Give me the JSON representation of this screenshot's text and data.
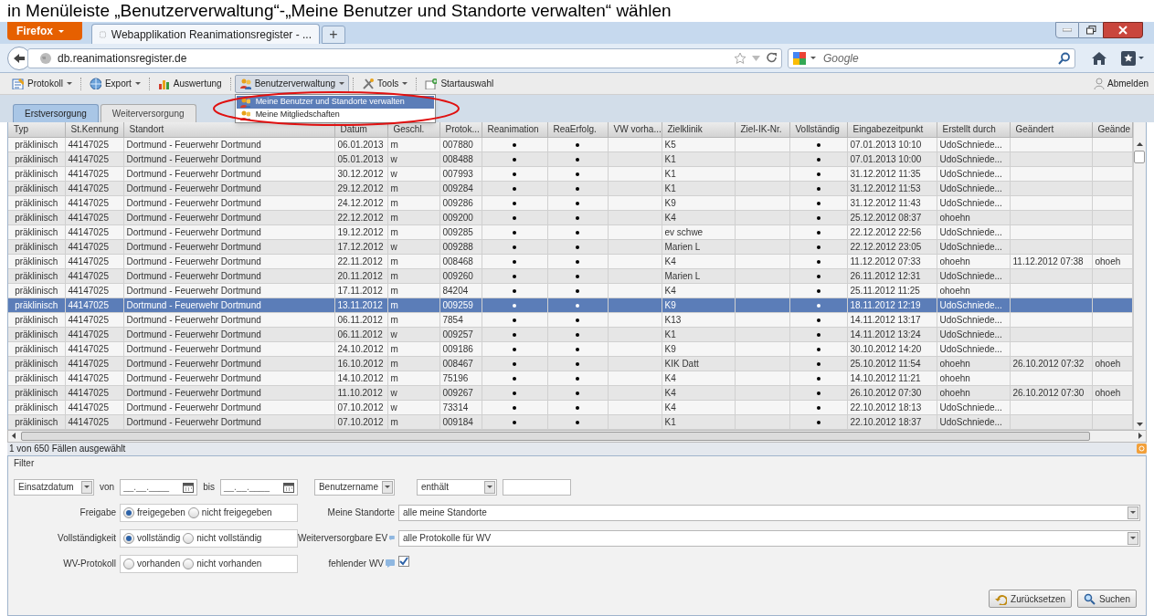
{
  "caption": "in Menüleiste „Benutzerverwaltung“-„Meine Benutzer und Standorte verwalten“ wählen",
  "browser": {
    "menu_button": "Firefox",
    "tabs": [
      {
        "title": "Webapplikation Reanimationsregister - ...",
        "selected": true
      }
    ],
    "new_tab": "+",
    "url": "db.reanimationsregister.de",
    "search_placeholder": "Google"
  },
  "toolbar": [
    {
      "label": "Protokoll",
      "dropdown": true,
      "active": false
    },
    {
      "label": "Export",
      "dropdown": true,
      "active": false
    },
    {
      "label": "Auswertung",
      "dropdown": false,
      "active": false
    },
    {
      "label": "Benutzerverwaltung",
      "dropdown": true,
      "active": true
    },
    {
      "label": "Tools",
      "dropdown": true,
      "active": false
    },
    {
      "label": "Startauswahl",
      "dropdown": false,
      "active": false
    }
  ],
  "logout": "Abmelden",
  "dropdown_menu": [
    {
      "label": "Meine Benutzer und Standorte verwalten",
      "selected": true
    },
    {
      "label": "Meine Mitgliedschaften",
      "selected": false
    }
  ],
  "tabs": [
    {
      "label": "Erstversorgung",
      "selected": true
    },
    {
      "label": "Weiterversorgung",
      "selected": false
    }
  ],
  "grid": {
    "columns": [
      {
        "label": "Typ",
        "kind": "text"
      },
      {
        "label": "St.Kennung",
        "kind": "text"
      },
      {
        "label": "Standort",
        "kind": "text"
      },
      {
        "label": "Datum",
        "kind": "text"
      },
      {
        "label": "Geschl.",
        "kind": "text"
      },
      {
        "label": "Protok...",
        "kind": "text"
      },
      {
        "label": "Reanimation",
        "kind": "flag"
      },
      {
        "label": "ReaErfolg.",
        "kind": "flag"
      },
      {
        "label": "VW vorha...",
        "kind": "flag"
      },
      {
        "label": "Zielklinik",
        "kind": "text"
      },
      {
        "label": "Ziel-IK-Nr.",
        "kind": "text"
      },
      {
        "label": "Vollständig",
        "kind": "flag"
      },
      {
        "label": "Eingabezeitpunkt",
        "kind": "text"
      },
      {
        "label": "Erstellt durch",
        "kind": "text"
      },
      {
        "label": "Geändert",
        "kind": "text"
      },
      {
        "label": "Geände",
        "kind": "text"
      }
    ],
    "rows": [
      {
        "selected": false,
        "cells": [
          "präklinisch",
          "44147025",
          "Dortmund - Feuerwehr Dortmund",
          "06.01.2013",
          "m",
          "007880",
          true,
          true,
          false,
          "K5",
          null,
          true,
          "07.01.2013 10:10",
          "UdoSchniede...",
          null,
          null
        ]
      },
      {
        "selected": false,
        "cells": [
          "präklinisch",
          "44147025",
          "Dortmund - Feuerwehr Dortmund",
          "05.01.2013",
          "w",
          "008488",
          true,
          true,
          false,
          "K1",
          null,
          true,
          "07.01.2013 10:00",
          "UdoSchniede...",
          null,
          null
        ]
      },
      {
        "selected": false,
        "cells": [
          "präklinisch",
          "44147025",
          "Dortmund - Feuerwehr Dortmund",
          "30.12.2012",
          "w",
          "007993",
          true,
          true,
          false,
          "K1",
          null,
          true,
          "31.12.2012 11:35",
          "UdoSchniede...",
          null,
          null
        ]
      },
      {
        "selected": false,
        "cells": [
          "präklinisch",
          "44147025",
          "Dortmund - Feuerwehr Dortmund",
          "29.12.2012",
          "m",
          "009284",
          true,
          true,
          false,
          "K1",
          null,
          true,
          "31.12.2012 11:53",
          "UdoSchniede...",
          null,
          null
        ]
      },
      {
        "selected": false,
        "cells": [
          "präklinisch",
          "44147025",
          "Dortmund - Feuerwehr Dortmund",
          "24.12.2012",
          "m",
          "009286",
          true,
          true,
          false,
          "K9",
          null,
          true,
          "31.12.2012 11:43",
          "UdoSchniede...",
          null,
          null
        ]
      },
      {
        "selected": false,
        "cells": [
          "präklinisch",
          "44147025",
          "Dortmund - Feuerwehr Dortmund",
          "22.12.2012",
          "m",
          "009200",
          true,
          true,
          false,
          "K4",
          null,
          true,
          "25.12.2012 08:37",
          "ohoehn",
          null,
          null
        ]
      },
      {
        "selected": false,
        "cells": [
          "präklinisch",
          "44147025",
          "Dortmund - Feuerwehr Dortmund",
          "19.12.2012",
          "m",
          "009285",
          true,
          true,
          false,
          "ev schwe",
          null,
          true,
          "22.12.2012 22:56",
          "UdoSchniede...",
          null,
          null
        ]
      },
      {
        "selected": false,
        "cells": [
          "präklinisch",
          "44147025",
          "Dortmund - Feuerwehr Dortmund",
          "17.12.2012",
          "w",
          "009288",
          true,
          true,
          false,
          "Marien L",
          null,
          true,
          "22.12.2012 23:05",
          "UdoSchniede...",
          null,
          null
        ]
      },
      {
        "selected": false,
        "cells": [
          "präklinisch",
          "44147025",
          "Dortmund - Feuerwehr Dortmund",
          "22.11.2012",
          "m",
          "008468",
          true,
          true,
          false,
          "K4",
          null,
          true,
          "11.12.2012 07:33",
          "ohoehn",
          "11.12.2012 07:38",
          "ohoeh"
        ]
      },
      {
        "selected": false,
        "cells": [
          "präklinisch",
          "44147025",
          "Dortmund - Feuerwehr Dortmund",
          "20.11.2012",
          "m",
          "009260",
          true,
          true,
          false,
          "Marien L",
          null,
          true,
          "26.11.2012 12:31",
          "UdoSchniede...",
          null,
          null
        ]
      },
      {
        "selected": false,
        "cells": [
          "präklinisch",
          "44147025",
          "Dortmund - Feuerwehr Dortmund",
          "17.11.2012",
          "m",
          "84204",
          true,
          true,
          false,
          "K4",
          null,
          true,
          "25.11.2012 11:25",
          "ohoehn",
          null,
          null
        ]
      },
      {
        "selected": true,
        "cells": [
          "präklinisch",
          "44147025",
          "Dortmund - Feuerwehr Dortmund",
          "13.11.2012",
          "m",
          "009259",
          true,
          true,
          false,
          "K9",
          null,
          true,
          "18.11.2012 12:19",
          "UdoSchniede...",
          null,
          null
        ]
      },
      {
        "selected": false,
        "cells": [
          "präklinisch",
          "44147025",
          "Dortmund - Feuerwehr Dortmund",
          "06.11.2012",
          "m",
          "7854",
          true,
          true,
          false,
          "K13",
          null,
          true,
          "14.11.2012 13:17",
          "UdoSchniede...",
          null,
          null
        ]
      },
      {
        "selected": false,
        "cells": [
          "präklinisch",
          "44147025",
          "Dortmund - Feuerwehr Dortmund",
          "06.11.2012",
          "w",
          "009257",
          true,
          true,
          false,
          "K1",
          null,
          true,
          "14.11.2012 13:24",
          "UdoSchniede...",
          null,
          null
        ]
      },
      {
        "selected": false,
        "cells": [
          "präklinisch",
          "44147025",
          "Dortmund - Feuerwehr Dortmund",
          "24.10.2012",
          "m",
          "009186",
          true,
          true,
          false,
          "K9",
          null,
          true,
          "30.10.2012 14:20",
          "UdoSchniede...",
          null,
          null
        ]
      },
      {
        "selected": false,
        "cells": [
          "präklinisch",
          "44147025",
          "Dortmund - Feuerwehr Dortmund",
          "16.10.2012",
          "m",
          "008467",
          true,
          true,
          false,
          "KIK Datt",
          null,
          true,
          "25.10.2012 11:54",
          "ohoehn",
          "26.10.2012 07:32",
          "ohoeh"
        ]
      },
      {
        "selected": false,
        "cells": [
          "präklinisch",
          "44147025",
          "Dortmund - Feuerwehr Dortmund",
          "14.10.2012",
          "m",
          "75196",
          true,
          true,
          false,
          "K4",
          null,
          true,
          "14.10.2012 11:21",
          "ohoehn",
          null,
          null
        ]
      },
      {
        "selected": false,
        "cells": [
          "präklinisch",
          "44147025",
          "Dortmund - Feuerwehr Dortmund",
          "11.10.2012",
          "w",
          "009267",
          true,
          true,
          false,
          "K4",
          null,
          true,
          "26.10.2012 07:30",
          "ohoehn",
          "26.10.2012 07:30",
          "ohoeh"
        ]
      },
      {
        "selected": false,
        "cells": [
          "präklinisch",
          "44147025",
          "Dortmund - Feuerwehr Dortmund",
          "07.10.2012",
          "w",
          "73314",
          true,
          true,
          false,
          "K4",
          null,
          true,
          "22.10.2012 18:13",
          "UdoSchniede...",
          null,
          null
        ]
      },
      {
        "selected": false,
        "cells": [
          "präklinisch",
          "44147025",
          "Dortmund - Feuerwehr Dortmund",
          "07.10.2012",
          "m",
          "009184",
          true,
          true,
          false,
          "K1",
          null,
          true,
          "22.10.2012 18:37",
          "UdoSchniede...",
          null,
          null
        ]
      }
    ]
  },
  "status": "1 von 650 Fällen ausgewählt",
  "filter": {
    "title": "Filter",
    "date_select": "Einsatzdatum",
    "from_label": "von",
    "from_value": "__.__.____",
    "to_label": "bis",
    "to_value": "__.__.____",
    "user_select": "Benutzername",
    "operator_select": "enthält",
    "radio_groups": [
      {
        "label": "Freigabe",
        "options": [
          {
            "label": "freigegeben",
            "selected": true
          },
          {
            "label": "nicht freigegeben",
            "selected": false
          }
        ]
      },
      {
        "label": "Vollständigkeit",
        "options": [
          {
            "label": "vollständig",
            "selected": true
          },
          {
            "label": "nicht vollständig",
            "selected": false
          }
        ]
      },
      {
        "label": "WV-Protokoll",
        "options": [
          {
            "label": "vorhanden",
            "selected": false
          },
          {
            "label": "nicht vorhanden",
            "selected": false
          }
        ]
      }
    ],
    "selects": [
      {
        "label": "Meine Standorte",
        "value": "alle meine Standorte",
        "info": false
      },
      {
        "label": "Weiterversorgbare EV",
        "value": "alle Protokolle für WV",
        "info": true
      }
    ],
    "missing_wv": {
      "label": "fehlender WV",
      "info": true,
      "checked": true
    },
    "buttons": [
      {
        "label": "Zurücksetzen"
      },
      {
        "label": "Suchen"
      }
    ]
  }
}
